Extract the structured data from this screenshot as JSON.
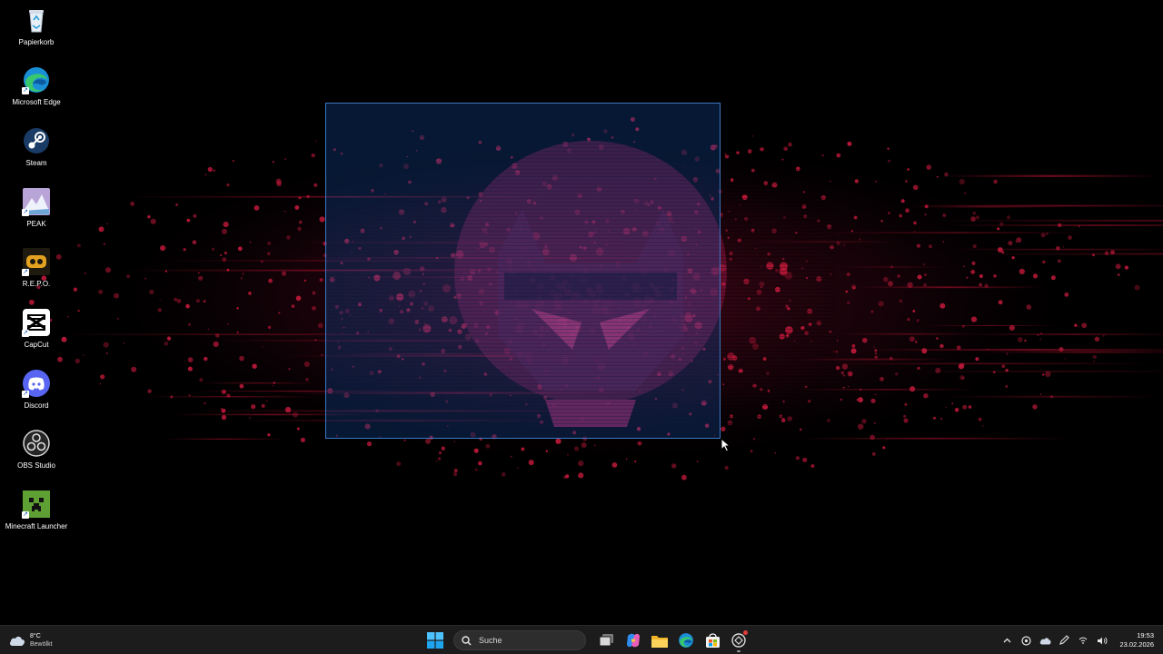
{
  "desktop": {
    "icons": [
      {
        "label": "Papierkorb",
        "icon": "recycle-bin-icon"
      },
      {
        "label": "Microsoft Edge",
        "icon": "edge-icon"
      },
      {
        "label": "Steam",
        "icon": "steam-icon"
      },
      {
        "label": "PEAK",
        "icon": "peak-icon"
      },
      {
        "label": "R.E.P.O.",
        "icon": "repo-icon"
      },
      {
        "label": "CapCut",
        "icon": "capcut-icon"
      },
      {
        "label": "Discord",
        "icon": "discord-icon"
      },
      {
        "label": "OBS Studio",
        "icon": "obs-icon"
      },
      {
        "label": "Minecraft Launcher",
        "icon": "minecraft-icon"
      }
    ]
  },
  "taskbar": {
    "weather": {
      "temp": "8°C",
      "condition": "Bewölkt"
    },
    "search": {
      "placeholder": "Suche"
    },
    "pinned": [
      "start-icon",
      "task-view-icon",
      "copilot-icon",
      "file-explorer-icon",
      "edge-icon",
      "microsoft-store-icon",
      "repo-app-icon"
    ],
    "clock": {
      "time": "19:53",
      "date": "23.02.2026"
    }
  },
  "colors": {
    "accent": "#3b78c4",
    "splatter": "#c0193a",
    "taskbar": "#1c1c1c"
  }
}
